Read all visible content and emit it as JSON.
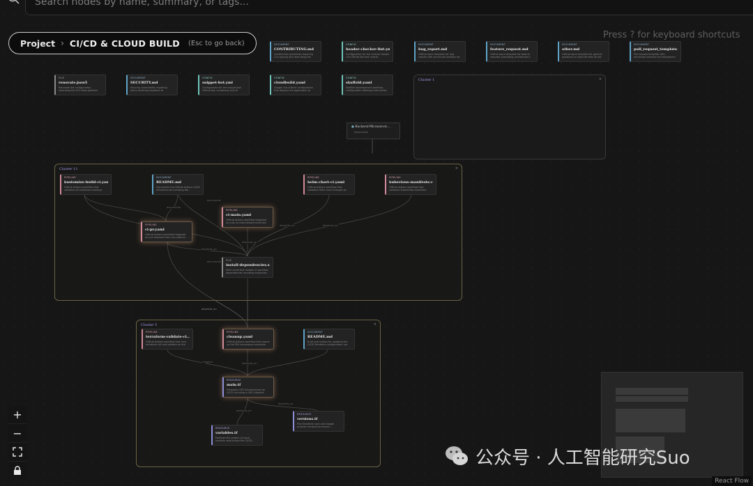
{
  "search": {
    "placeholder": "Search nodes by name, summary, or tags..."
  },
  "breadcrumb": {
    "project": "Project",
    "separator": "›",
    "current": "CI/CD & CLOUD BUILD",
    "hint": "(Esc to go back)"
  },
  "shortcut_hint": "Press ? for keyboard shortcuts",
  "top_nodes": [
    {
      "type": "DOCUMENT",
      "name": "CONTRIBUTING.md",
      "desc": "Contribution guidelines requiring CLA signing and describing the",
      "kind": "doc"
    },
    {
      "type": "CONFIG",
      "name": "header-checker-lint.yml",
      "desc": "Configuration for the License Header Lint GitHub bot that checks",
      "kind": "config"
    },
    {
      "type": "DOCUMENT",
      "name": "bug_report.md",
      "desc": "GitHub issue template for bug reports with structured sections for",
      "kind": "doc"
    },
    {
      "type": "DOCUMENT",
      "name": "feature_request.md",
      "desc": "GitHub issue template for feature requests prompting contributors t",
      "kind": "doc"
    },
    {
      "type": "DOCUMENT",
      "name": "other.md",
      "desc": "GitHub issue template for general questions or inquiries that do not",
      "kind": "doc"
    },
    {
      "type": "DOCUMENT",
      "name": "pull_request_template.md",
      "desc": "Pull request template with structured sections for background",
      "kind": "doc"
    }
  ],
  "row2_nodes": [
    {
      "type": "FILE",
      "name": "renovate.json5",
      "desc": "Renovate bot configuration extending the GCP base platform",
      "kind": "file"
    },
    {
      "type": "DOCUMENT",
      "name": "SECURITY.md",
      "desc": "Security vulnerability reporting policy directing reporters to",
      "kind": "doc"
    },
    {
      "type": "CONFIG",
      "name": "snippet-bot.yml",
      "desc": "Configuration for the snippet-bot GitHub bot, containing only th",
      "kind": "config"
    },
    {
      "type": "CONFIG",
      "name": "cloudbuild.yaml",
      "desc": "Google Cloud Build configuration that deploys the application to",
      "kind": "config"
    },
    {
      "type": "CONFIG",
      "name": "skaffold.yaml",
      "desc": "Skaffold development workflow configuration defining build artifac",
      "kind": "config"
    }
  ],
  "backend_node": {
    "name": "Backend Microservic...",
    "sub": "Kubernetes"
  },
  "cluster_labels": {
    "c1": "Cluster 1",
    "c2": "Cluster 11",
    "c3": "Cluster 5"
  },
  "cluster11_nodes": [
    {
      "type": "PIPELINE",
      "name": "kustomize-build-ci.yaml",
      "desc": "GitHub Actions workflow that validates all kustomize overlays",
      "kind": "pipeline"
    },
    {
      "type": "DOCUMENT",
      "name": "README.md",
      "desc": "Documents the GitHub Actions CI/CD infrastructure including Wo...",
      "kind": "doc"
    },
    {
      "type": "PIPELINE",
      "name": "helm-chart-ci.yaml",
      "desc": "GitHub Actions workflow that validates Helm chart changes by",
      "kind": "pipeline"
    },
    {
      "type": "PIPELINE",
      "name": "kubevious-manifests-ci...",
      "desc": "GitHub Actions workflow that validates Kubernetes manifests",
      "kind": "pipeline"
    },
    {
      "type": "PIPELINE",
      "name": "ci-main.yaml",
      "desc": "GitHub Actions workflow triggered on push to main/release branches",
      "kind": "pipeline"
    },
    {
      "type": "PIPELINE",
      "name": "ci-pr.yaml",
      "desc": "GitHub Actions workflow triggered on pull requests that runs code te...",
      "kind": "pipeline"
    },
    {
      "type": "FILE",
      "name": "install-dependencies.sh",
      "desc": "Shell script that installs CI workflow dependencies including kustomize",
      "kind": "file"
    }
  ],
  "cluster5_nodes": [
    {
      "type": "PIPELINE",
      "name": "terraform-validate-ci...",
      "desc": "GitHub Actions workflow that runs terraform init and validate on the",
      "kind": "pipeline"
    },
    {
      "type": "PIPELINE",
      "name": "cleanup.yaml",
      "desc": "GitHub Actions workflow that cleans up the PRs namespace associate",
      "kind": "pipeline"
    },
    {
      "type": "DOCUMENT",
      "name": "README.md",
      "desc": "Brief instructions for updating the CI/CD Terraform configuration use",
      "kind": "doc"
    },
    {
      "type": "RESOURCE",
      "name": "main.tf",
      "desc": "Provisions GCP infrastructure for CI/CD including a GKE Autopilot",
      "kind": "resource"
    },
    {
      "type": "RESOURCE",
      "name": "versions.tf",
      "desc": "Pins Terraform core and Google provider versions to ensure...",
      "kind": "resource"
    },
    {
      "type": "RESOURCE",
      "name": "variables.tf",
      "desc": "Declares the project_id input variable used across the CI/CD...",
      "kind": "resource"
    }
  ],
  "edge_labels": [
    "documents",
    "documents",
    "depends_on",
    "depends_on",
    "depends_on",
    "depends_on",
    "documents",
    "depends_on",
    "triggers",
    "depends_on",
    "depends_on",
    "depends_on",
    "depends_on"
  ],
  "controls": {
    "zoom_in": "+",
    "zoom_out": "−",
    "fit": "⛶",
    "lock": "🔒"
  },
  "attribution": "React Flow",
  "watermark": "公众号 · 人工智能研究Suo"
}
